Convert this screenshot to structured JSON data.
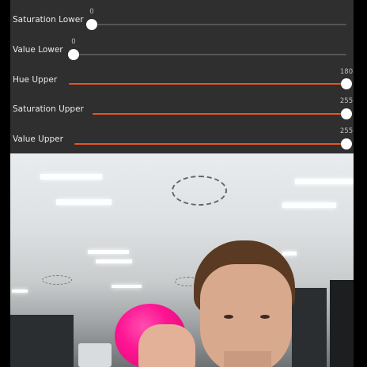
{
  "sliders": [
    {
      "label": "Saturation Lower",
      "value": "0",
      "fraction": 0.0
    },
    {
      "label": "Value Lower",
      "value": "0",
      "fraction": 0.0
    },
    {
      "label": "Hue Upper",
      "value": "180",
      "fraction": 1.0
    },
    {
      "label": "Saturation Upper",
      "value": "255",
      "fraction": 1.0
    },
    {
      "label": "Value Upper",
      "value": "255",
      "fraction": 1.0
    }
  ],
  "colors": {
    "accent": "#e9541f",
    "knob": "#ffffff",
    "track": "#555555",
    "panel": "#2f2f2f"
  },
  "camera": {
    "subject": "camera-feed"
  }
}
